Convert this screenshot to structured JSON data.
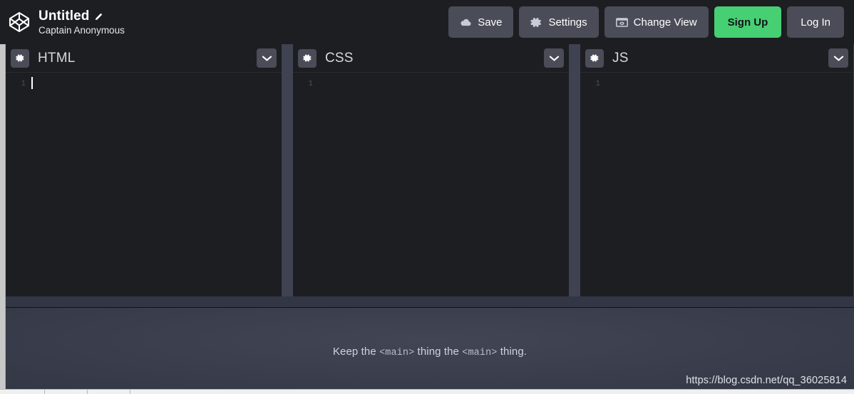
{
  "header": {
    "logo_icon": "codepen-logo-icon",
    "pen_title": "Untitled",
    "edit_icon": "pencil-icon",
    "author": "Captain Anonymous",
    "buttons": [
      {
        "id": "save",
        "label": "Save",
        "icon": "cloud-icon",
        "style": "default"
      },
      {
        "id": "settings",
        "label": "Settings",
        "icon": "gear-icon",
        "style": "default"
      },
      {
        "id": "change-view",
        "label": "Change View",
        "icon": "layout-icon",
        "style": "default"
      },
      {
        "id": "signup",
        "label": "Sign Up",
        "icon": "",
        "style": "primary"
      },
      {
        "id": "login",
        "label": "Log In",
        "icon": "",
        "style": "default"
      }
    ]
  },
  "editors": [
    {
      "id": "html",
      "label": "HTML",
      "settings_icon": "gear-icon",
      "collapse_icon": "chevron-down-icon",
      "line_numbers": [
        "1"
      ],
      "content": "",
      "caret_visible": true
    },
    {
      "id": "css",
      "label": "CSS",
      "settings_icon": "gear-icon",
      "collapse_icon": "chevron-down-icon",
      "line_numbers": [
        "1"
      ],
      "content": "",
      "caret_visible": false
    },
    {
      "id": "js",
      "label": "JS",
      "settings_icon": "gear-icon",
      "collapse_icon": "chevron-down-icon",
      "line_numbers": [
        "1"
      ],
      "content": "",
      "caret_visible": false
    }
  ],
  "preview": {
    "tagline_prefix": "Keep the ",
    "tagline_tag1": "<main>",
    "tagline_middle": " thing the ",
    "tagline_tag2": "<main>",
    "tagline_suffix": " thing."
  },
  "watermark": {
    "text": "https://blog.csdn.net/qq_36025814"
  },
  "colors": {
    "app_background": "#1d1e22",
    "button_background": "#4a4d58",
    "accent_green": "#47cf73",
    "divider": "#3f4250",
    "preview_background": "#3b3f4d",
    "text_primary": "#ffffff",
    "pane_label": "#d7d8db",
    "line_number": "#4c4e55"
  }
}
